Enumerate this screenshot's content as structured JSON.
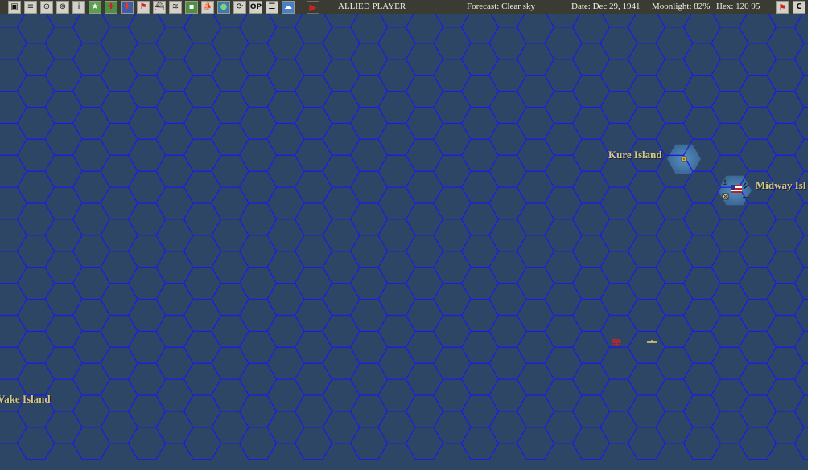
{
  "toolbar": {
    "buttons": [
      {
        "name": "map-view-icon"
      },
      {
        "name": "report-icon"
      },
      {
        "name": "target-icon"
      },
      {
        "name": "group-icon"
      },
      {
        "name": "info-icon"
      },
      {
        "name": "victory-star-icon"
      },
      {
        "name": "air-unit-icon"
      },
      {
        "name": "bomber-icon"
      },
      {
        "name": "flag-icon"
      },
      {
        "name": "ship-icon"
      },
      {
        "name": "convoy-icon"
      },
      {
        "name": "base-icon"
      },
      {
        "name": "fleet-icon"
      },
      {
        "name": "globe-icon"
      },
      {
        "name": "cycle-icon"
      },
      {
        "name": "ops-icon"
      },
      {
        "name": "list-icon"
      },
      {
        "name": "weather-icon"
      },
      {
        "name": "end-turn-icon"
      }
    ],
    "ops_label": "OP",
    "player": "ALLIED PLAYER",
    "forecast": "Forecast: Clear sky",
    "date": "Date: Dec 29, 1941",
    "moonlight": "Moonlight: 82%",
    "hex": "Hex: 120 95",
    "right_buttons": [
      {
        "name": "nation-flag-icon"
      },
      {
        "name": "c-button",
        "label": "C"
      }
    ]
  },
  "colors": {
    "ocean": "#2e4666",
    "hex_grid": "#1a1ee0",
    "shallow": "#4f86b8",
    "label": "#d8c888",
    "topbar": "#3a3c33"
  },
  "map": {
    "places": [
      {
        "id": "kure",
        "label": "Kure Island"
      },
      {
        "id": "midway",
        "label": "Midway Isl"
      },
      {
        "id": "wake",
        "label": "Vake Island"
      }
    ]
  }
}
